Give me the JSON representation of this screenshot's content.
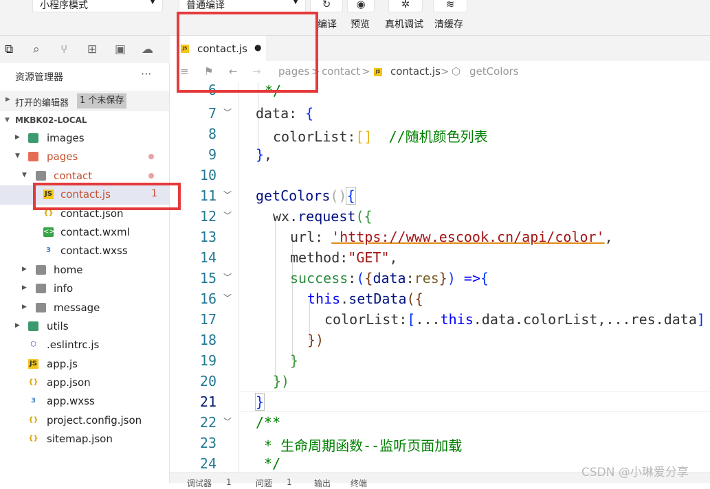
{
  "toolbar": {
    "mode_select": "小程序模式",
    "compile_select": "普通编译",
    "compile_label": "编译",
    "preview_label": "预览",
    "device_debug_label": "真机调试",
    "clear_cache_label": "清缓存"
  },
  "sidebar": {
    "title": "资源管理器",
    "more": "···",
    "open_editors_label": "打开的编辑器",
    "unsaved_badge": "1 个未保存",
    "project_label": "MKBK02-LOCAL",
    "tree": [
      {
        "label": "images"
      },
      {
        "label": "pages"
      },
      {
        "label": "contact"
      },
      {
        "label": "contact.js",
        "problems": "1"
      },
      {
        "label": "contact.json"
      },
      {
        "label": "contact.wxml"
      },
      {
        "label": "contact.wxss"
      },
      {
        "label": "home"
      },
      {
        "label": "info"
      },
      {
        "label": "message"
      },
      {
        "label": "utils"
      },
      {
        "label": ".eslintrc.js"
      },
      {
        "label": "app.js"
      },
      {
        "label": "app.json"
      },
      {
        "label": "app.wxss"
      },
      {
        "label": "project.config.json"
      },
      {
        "label": "sitemap.json"
      }
    ]
  },
  "editor": {
    "tab_label": "contact.js",
    "tab_modified": "●",
    "breadcrumbs": [
      "pages",
      ">",
      "contact",
      ">",
      "contact.js",
      ">",
      "getColors"
    ],
    "lines": [
      {
        "num": "6"
      },
      {
        "num": "7"
      },
      {
        "num": "8"
      },
      {
        "num": "9"
      },
      {
        "num": "10"
      },
      {
        "num": "11"
      },
      {
        "num": "12"
      },
      {
        "num": "13"
      },
      {
        "num": "14"
      },
      {
        "num": "15"
      },
      {
        "num": "16"
      },
      {
        "num": "17"
      },
      {
        "num": "18"
      },
      {
        "num": "19"
      },
      {
        "num": "20"
      },
      {
        "num": "21"
      },
      {
        "num": "22"
      },
      {
        "num": "23"
      },
      {
        "num": "24"
      }
    ],
    "code": {
      "l6": "*/",
      "l7a": "data",
      "l7b": ": ",
      "l7c": "{",
      "l8a": "colorList",
      "l8b": ":",
      "l8c": "[]",
      "l8d": "  //随机颜色列表",
      "l9a": "}",
      "l9b": ",",
      "l11a": "getColors",
      "l11b": "()",
      "l11c": "{",
      "l12a": "wx",
      "l12b": ".",
      "l12c": "request",
      "l12d": "(",
      "l12e": "{",
      "l13a": "url",
      "l13b": ": ",
      "l13c": "'https://www.escook.cn/api/color'",
      "l13d": ",",
      "l14a": "method",
      "l14b": ":",
      "l14c": "\"GET\"",
      "l14d": ",",
      "l15a": "success",
      "l15b": ":",
      "l15c": "(",
      "l15d": "{",
      "l15e": "data",
      "l15f": ":",
      "l15g": "res",
      "l15h": "}",
      "l15i": ")",
      "l15j": " =>",
      "l15k": "{",
      "l16a": "this",
      "l16b": ".",
      "l16c": "setData",
      "l16d": "(",
      "l16e": "{",
      "l17a": "colorList",
      "l17b": ":",
      "l17c": "[",
      "l17d": "...",
      "l17e": "this",
      "l17f": ".data.colorList,...res.data",
      "l17g": "]",
      "l18a": "}",
      "l18b": ")",
      "l19": "}",
      "l20a": "}",
      "l20b": ")",
      "l21": "}",
      "l22": "/**",
      "l23": " * 生命周期函数--监听页面加载",
      "l24": " */"
    }
  },
  "statusbar": {
    "items": [
      "调试器",
      "1",
      "问题",
      "1",
      "输出",
      "终端"
    ]
  },
  "watermark": "CSDN @小琳爱分享",
  "colors": {
    "highlight_box": "#e43a3c",
    "keyword": "#0000ff",
    "string": "#a31515",
    "comment": "#008000"
  }
}
